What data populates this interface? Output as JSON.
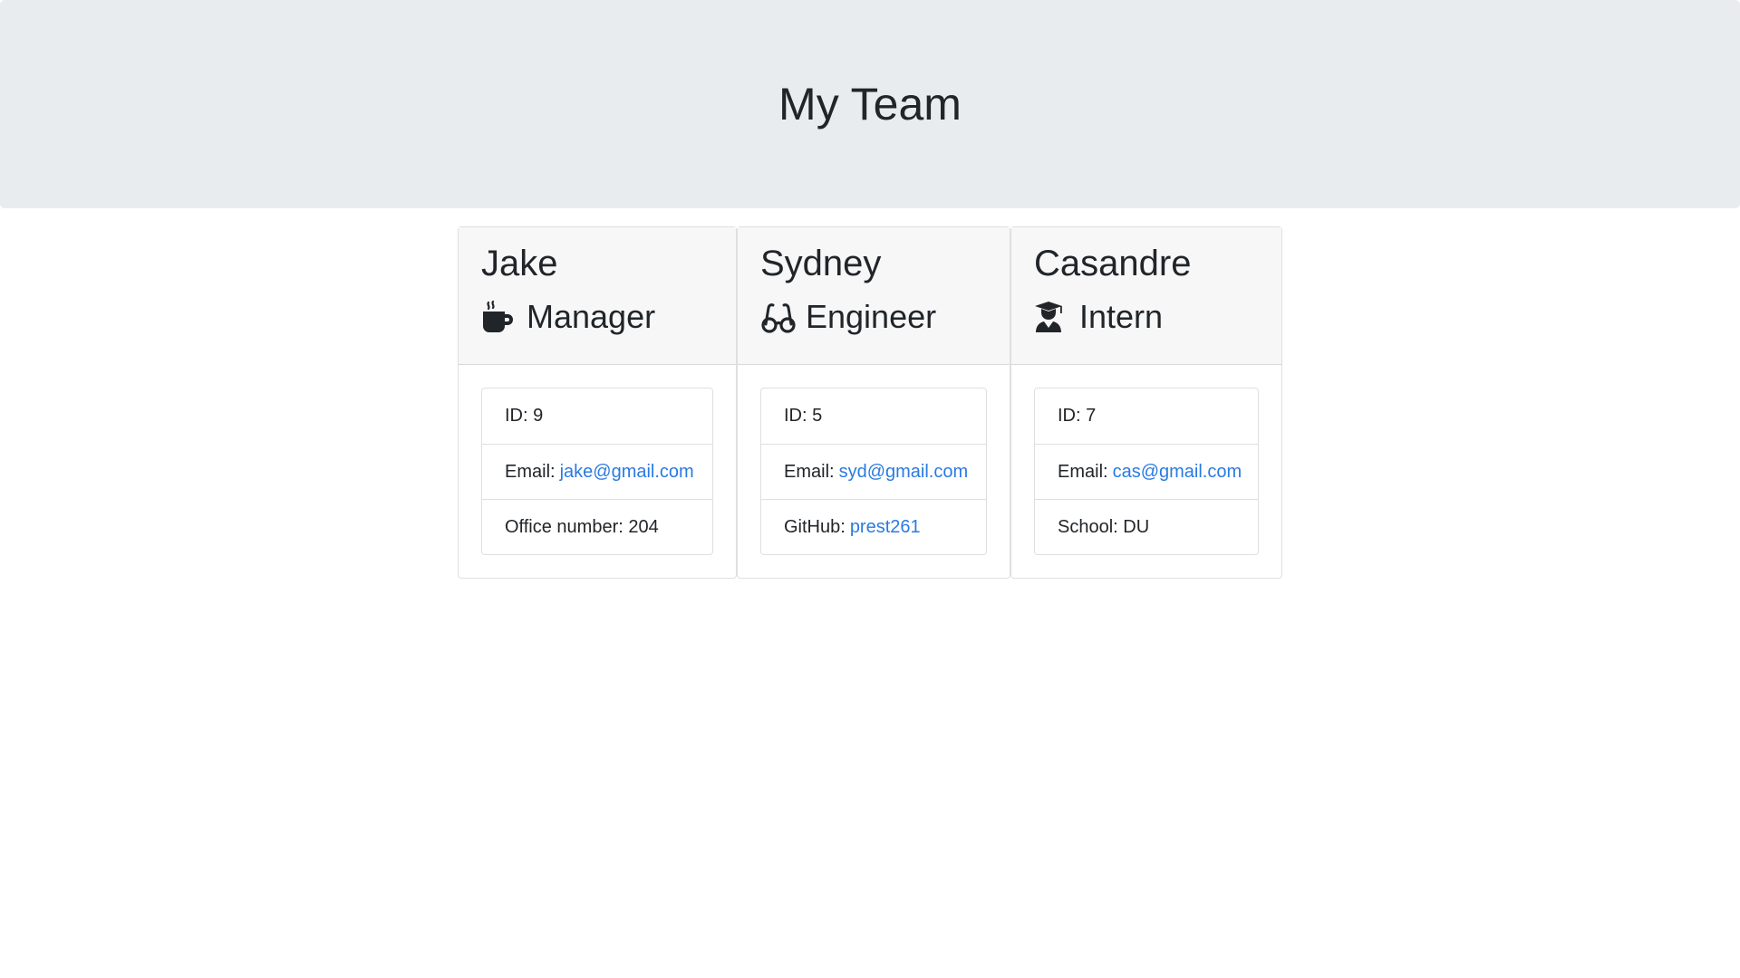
{
  "header": {
    "title": "My Team"
  },
  "team": [
    {
      "name": "Jake",
      "role": "Manager",
      "icon": "coffee-icon",
      "id_label": "ID: 9",
      "email_prefix": "Email:",
      "email": "jake@gmail.com",
      "extra_label": "Office number: 204",
      "extra_link": ""
    },
    {
      "name": "Sydney",
      "role": "Engineer",
      "icon": "glasses-icon",
      "id_label": "ID: 5",
      "email_prefix": "Email:",
      "email": "syd@gmail.com",
      "extra_label": "GitHub:",
      "extra_link": "prest261"
    },
    {
      "name": "Casandre",
      "role": "Intern",
      "icon": "graduate-icon",
      "id_label": "ID: 7",
      "email_prefix": "Email:",
      "email": "cas@gmail.com",
      "extra_label": "School: DU",
      "extra_link": ""
    }
  ],
  "colors": {
    "header_bg": "#e9ecef",
    "card_header_bg": "#f7f7f7",
    "link": "#2a7ae2",
    "text": "#212529"
  }
}
